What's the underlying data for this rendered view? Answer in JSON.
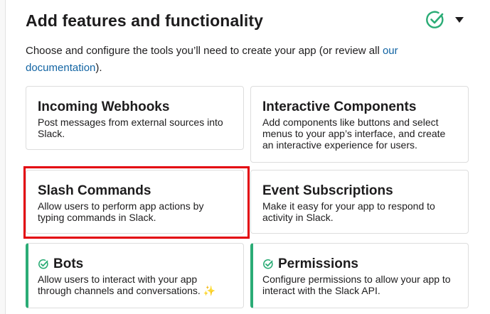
{
  "header": {
    "title": "Add features and functionality",
    "description_prefix": "Choose and configure the tools you’ll need to create your app (or review all ",
    "description_link": "our documentation",
    "description_suffix": ").",
    "status_icon": "check-circle-icon",
    "dropdown_icon": "caret-down-icon"
  },
  "colors": {
    "enabled_accent": "#2bac76",
    "link": "#1264a3",
    "highlight": "#e3000b"
  },
  "features": [
    {
      "title": "Incoming Webhooks",
      "description": "Post messages from external sources into Slack.",
      "enabled": false
    },
    {
      "title": "Interactive Components",
      "description": "Add components like buttons and select menus to your app’s interface, and create an interactive experience for users.",
      "enabled": false
    },
    {
      "title": "Slash Commands",
      "description": "Allow users to perform app actions by typing commands in Slack.",
      "enabled": false,
      "highlighted": true
    },
    {
      "title": "Event Subscriptions",
      "description": "Make it easy for your app to respond to activity in Slack.",
      "enabled": false
    },
    {
      "title": "Bots",
      "description": "Allow users to interact with your app through channels and conversations. ✨",
      "enabled": true
    },
    {
      "title": "Permissions",
      "description": "Configure permissions to allow your app to interact with the Slack API.",
      "enabled": true
    }
  ]
}
